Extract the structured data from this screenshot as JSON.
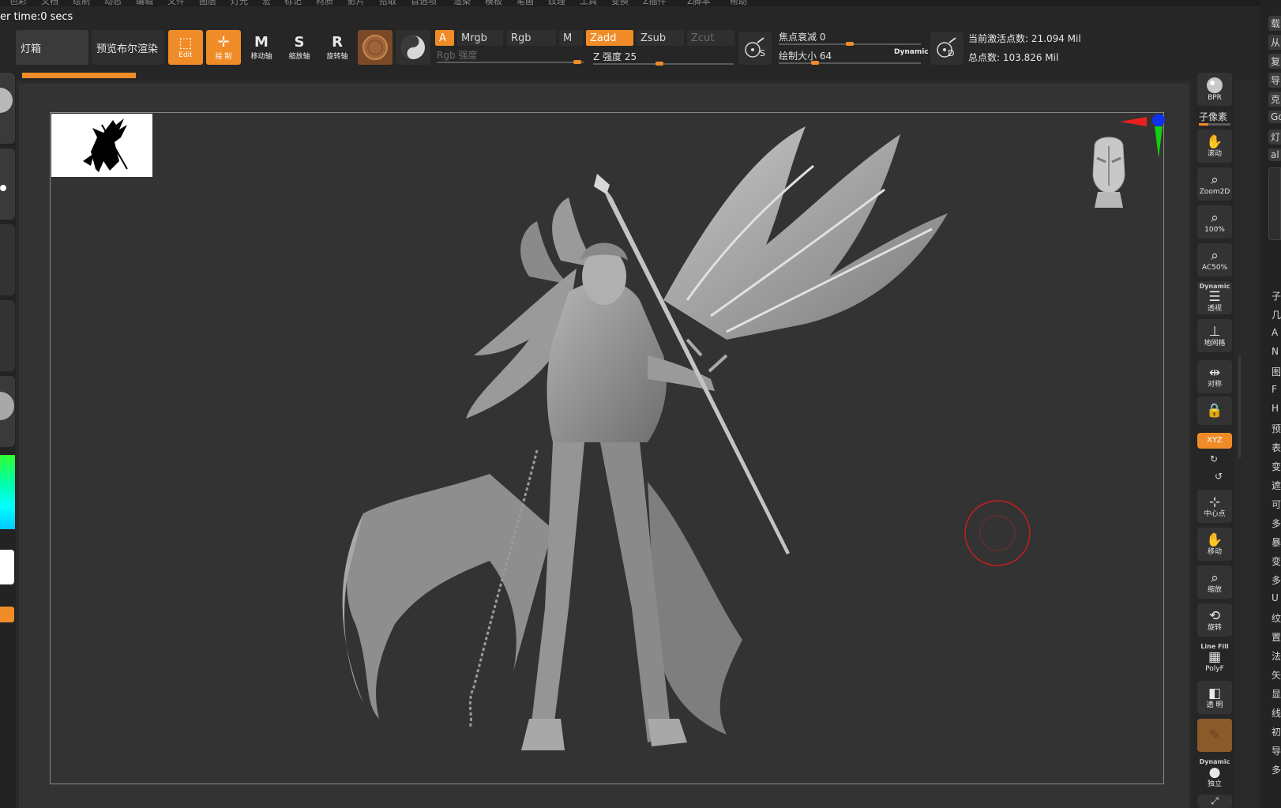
{
  "menu": [
    "色彩",
    "文档",
    "绘制",
    "动态",
    "编辑",
    "文件",
    "图层",
    "灯光",
    "宏",
    "标记",
    "材质",
    "影片",
    "拾取",
    "首选项",
    "渲染",
    "模板",
    "笔画",
    "纹理",
    "工具",
    "变换",
    "Z插件",
    "Z脚本",
    "帮助"
  ],
  "render_time": "er time:0 secs",
  "buttons": {
    "lightbox": "灯箱",
    "bpr_preview": "预览布尔渲染",
    "edit": "Edit",
    "draw": "绘 制",
    "move": "移动轴",
    "scale": "缩放轴",
    "rotate": "旋转轴"
  },
  "channels": {
    "a": "A",
    "mrgb": "Mrgb",
    "rgb": "Rgb",
    "m": "M",
    "zadd": "Zadd",
    "zsub": "Zsub",
    "zcut": "Zcut",
    "rgb_intensity": "Rgb 强度",
    "z_intensity": "Z 强度 25"
  },
  "brush": {
    "focal_shift": "焦点衰减 0",
    "draw_size": "绘制大小 64",
    "dynamic": "Dynamic",
    "s_label": "S",
    "d_label": "D"
  },
  "stats": {
    "active_points": "当前激活点数: 21.094 Mil",
    "total_points": "总点数: 103.826 Mil"
  },
  "right_shelf": {
    "bpr": "BPR",
    "subpixel": "子像素",
    "scroll": "滚动",
    "zoom2d": "Zoom2D",
    "pct100": "100%",
    "ac50": "AC50%",
    "persp_top": "Dynamic",
    "persp": "透视",
    "floor": "地网格",
    "sym": "对称",
    "xyz": "XYZ",
    "center": "中心点",
    "move": "移动",
    "zoom": "缩放",
    "rotate": "旋转",
    "polyf_top": "Line Fill",
    "polyf": "PolyF",
    "transp": "透 明",
    "solo_top": "Dynamic",
    "solo": "独立"
  },
  "far_right": [
    "载",
    "从",
    "复",
    "导",
    "克",
    "Go",
    "灯",
    "al",
    "子",
    "几",
    "A",
    "N",
    "图",
    "F",
    "H",
    "预",
    "表",
    "变",
    "遮",
    "可",
    "多",
    "暴",
    "变",
    "多",
    "U",
    "纹",
    "置",
    "法",
    "矢",
    "显",
    "线",
    "初",
    "导",
    "多"
  ],
  "colors": {
    "accent": "#f08c28",
    "background": "#333333"
  },
  "icons": {
    "gyro": "gyro-widget-icon",
    "head": "head-navigation-icon",
    "brush_cursor": "brush-cursor-icon"
  }
}
